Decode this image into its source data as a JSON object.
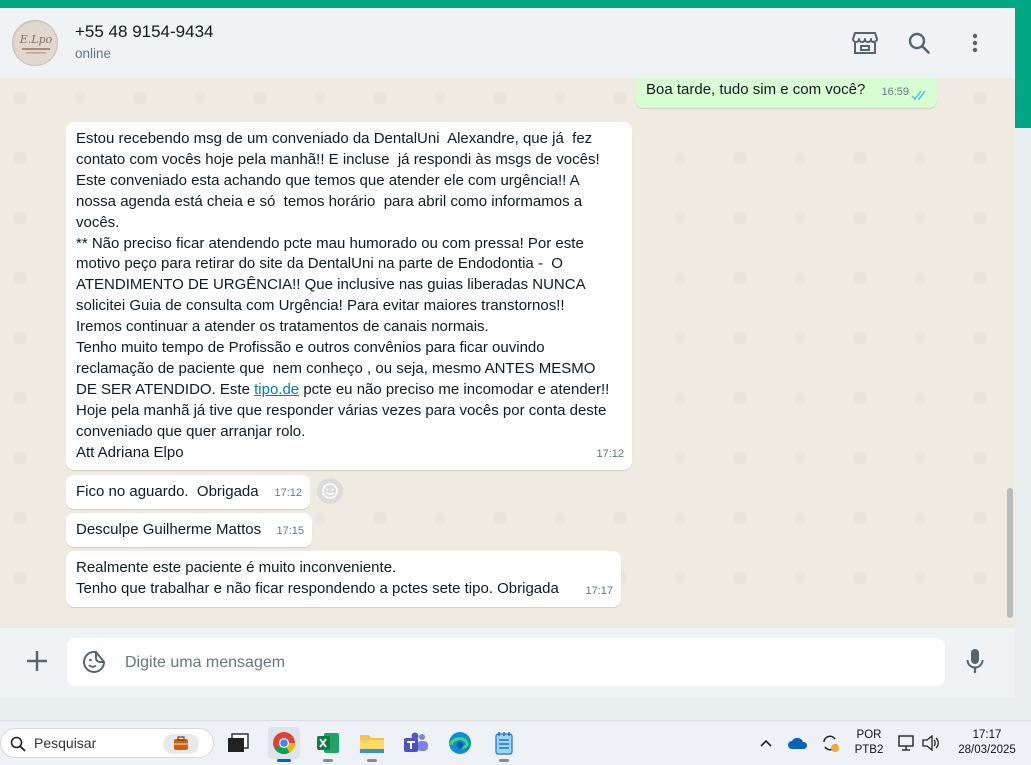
{
  "header": {
    "contact_name": "+55 48 9154-9434",
    "status": "online",
    "avatar_text": "E.Lpo"
  },
  "icons": {
    "shop": "storefront-icon",
    "search": "search-icon",
    "menu": "kebab-menu-icon",
    "add": "plus-icon",
    "sticker": "sticker-icon",
    "mic": "microphone-icon"
  },
  "messages": [
    {
      "direction": "out",
      "text": "Boa tarde, tudo sim e com você?",
      "time": "16:59",
      "status": "read"
    },
    {
      "direction": "in",
      "text_before_link": "Estou recebendo msg de um conveniado da DentalUni  Alexandre, que já  fez\ncontato com vocês hoje pela manhã!! E incluse  já respondi às msgs de vocês!\nEste conveniado esta achando que temos que atender ele com urgência!! A\nnossa agenda está cheia e só  temos horário  para abril como informamos a\nvocês.\n** Não preciso ficar atendendo pcte mau humorado ou com pressa! Por este\nmotivo peço para retirar do site da DentalUni na parte de Endodontia -  O\nATENDIMENTO DE URGÊNCIA!! Que inclusive nas guias liberadas NUNCA\nsolicitei Guia de consulta com Urgência! Para evitar maiores transtornos!!\nIremos continuar a atender os tratamentos de canais normais.\nTenho muito tempo de Profissão e outros convênios para ficar ouvindo\nreclamação de paciente que  nem conheço , ou seja, mesmo ANTES MESMO\nDE SER ATENDIDO. Este ",
      "link": "tipo.de",
      "text_after_link": " pcte eu não preciso me incomodar e atender!!\nHoje pela manhã já tive que responder várias vezes para vocês por conta deste\nconveniado que quer arranjar rolo.\nAtt Adriana Elpo",
      "time": "17:12"
    },
    {
      "direction": "in",
      "text": "Fico no aguardo.  Obrigada",
      "time": "17:12"
    },
    {
      "direction": "in",
      "text": "Desculpe Guilherme Mattos",
      "time": "17:15"
    },
    {
      "direction": "in",
      "text": "Realmente este paciente é muito inconveniente.\nTenho que trabalhar e não ficar respondendo a pctes sete tipo. Obrigada",
      "time": "17:17"
    }
  ],
  "composer": {
    "placeholder": "Digite uma mensagem"
  },
  "taskbar": {
    "search_label": "Pesquisar",
    "apps": [
      "task-view",
      "chrome",
      "excel",
      "file-explorer",
      "teams",
      "edge",
      "notepad"
    ],
    "language_line1": "POR",
    "language_line2": "PTB2",
    "clock_time": "17:17",
    "clock_date": "28/03/2025"
  },
  "colors": {
    "accent": "#00a884",
    "outgoing_bubble": "#d9fdd3",
    "incoming_bubble": "#ffffff",
    "read_ticks": "#53bdeb",
    "link": "#027eb5"
  }
}
